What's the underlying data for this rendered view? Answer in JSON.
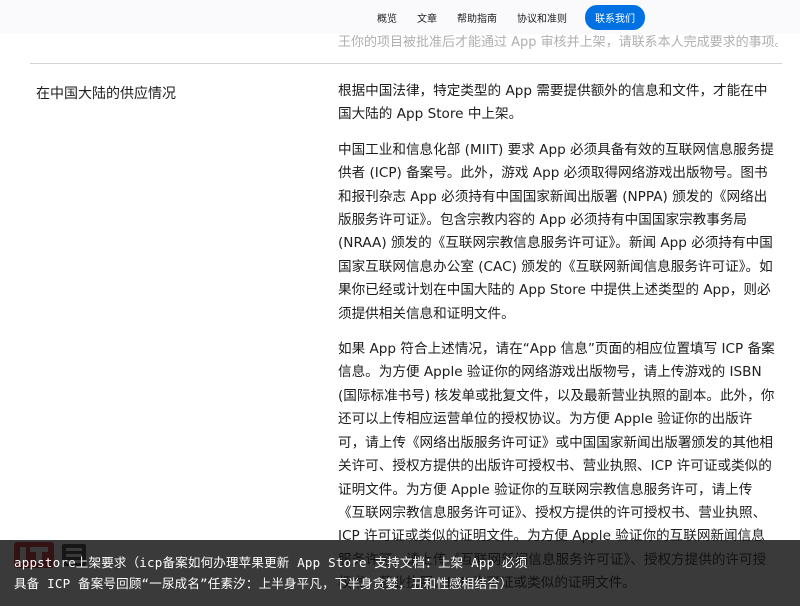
{
  "nav": {
    "items": [
      "概览",
      "文章",
      "帮助指南",
      "协议和准则"
    ],
    "cta": "联系我们"
  },
  "faded_top_text": "王你的项目被批准后才能通过 App 审核并上架，请联系本人完成要求的事项。",
  "section": {
    "label": "在中国大陆的供应情况",
    "paragraphs": [
      "根据中国法律，特定类型的 App 需要提供额外的信息和文件，才能在中国大陆的 App Store 中上架。",
      "中国工业和信息化部 (MIIT) 要求 App 必须具备有效的互联网信息服务提供者 (ICP) 备案号。此外，游戏 App 必须取得网络游戏出版物号。图书和报刊杂志 App 必须持有中国国家新闻出版署 (NPPA) 颁发的《网络出版服务许可证》。包含宗教内容的 App 必须持有中国国家宗教事务局 (NRAA) 颁发的《互联网宗教信息服务许可证》。新闻 App 必须持有中国国家互联网信息办公室 (CAC) 颁发的《互联网新闻信息服务许可证》。如果你已经或计划在中国大陆的 App Store 中提供上述类型的 App，则必须提供相关信息和证明文件。",
      "如果 App 符合上述情况，请在“App 信息”页面的相应位置填写 ICP 备案信息。为方便 Apple 验证你的网络游戏出版物号，请上传游戏的 ISBN (国际标准书号) 核发单或批复文件，以及最新营业执照的副本。此外，你还可以上传相应运营单位的授权协议。为方便 Apple 验证你的出版许可，请上传《网络出版服务许可证》或中国国家新闻出版署颁发的其他相关许可、授权方提供的出版许可授权书、营业执照、ICP 许可证或类似的证明文件。为方便 Apple 验证你的互联网宗教信息服务许可，请上传《互联网宗教信息服务许可证》、授权方提供的许可授权书、营业执照、ICP 许可证或类似的证明文件。为方便 Apple 验证你的互联网新闻信息服务许可，请上传《互联网新闻信息服务许可证》、授权方提供的许可授权书、营业执照、ICP 许可证或类似的证明文件。"
    ]
  },
  "caption": {
    "line1": "appstore上架要求（icp备案如何办理苹果更新 App Store 支持文档：上架 App 必须",
    "line2": "具备 ICP 备案号回顾“一尿成名”任素汐：上半身平凡，下半身贪婪，丑和性感相结合）"
  },
  "logo": {
    "text": "IT之家"
  },
  "colors": {
    "accent": "#0071e3",
    "logo_red": "#d6262b"
  }
}
